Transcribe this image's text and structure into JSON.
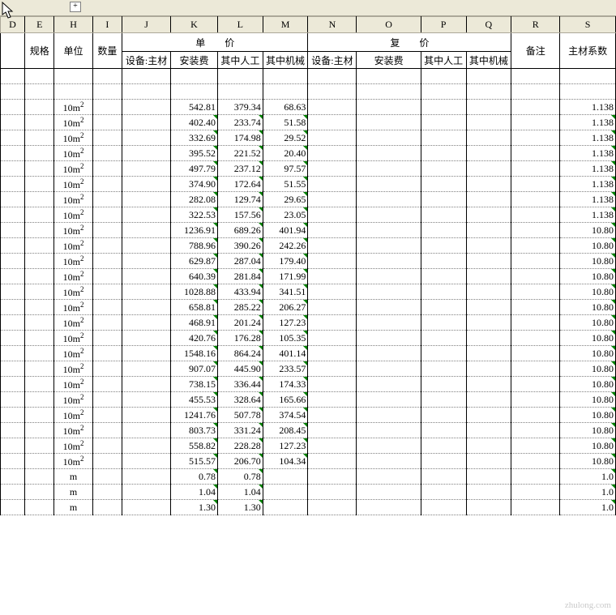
{
  "expand": "+",
  "columns": [
    "D",
    "E",
    "H",
    "I",
    "J",
    "K",
    "L",
    "M",
    "N",
    "O",
    "P",
    "Q",
    "R",
    "S"
  ],
  "header1": {
    "gg": "规格",
    "dw": "单位",
    "sl": "数量",
    "dj": "单　　价",
    "fj": "复　　价",
    "bz": "备注",
    "zcxs": "主材系数"
  },
  "header2": {
    "sbzc": "设备:主材",
    "azf": "安装费",
    "qzrg": "其中人工",
    "qzjx": "其中机械",
    "sbzc2": "设备:主材",
    "azf2": "安装费",
    "qzrg2": "其中人工",
    "qzjx2": "其中机械"
  },
  "unit10m2": "10m²",
  "unitM": "m",
  "rows": [
    {
      "type": "blank"
    },
    {
      "type": "blank"
    },
    {
      "u": "10m2",
      "k": "542.81",
      "l": "379.34",
      "m": "68.63",
      "s": "1.138",
      "ktri": 0,
      "ltri": 0,
      "mtri": 0,
      "stri": 0
    },
    {
      "u": "10m2",
      "k": "402.40",
      "l": "233.74",
      "m": "51.58",
      "s": "1.138",
      "ktri": 1,
      "ltri": 1,
      "mtri": 1,
      "stri": 1
    },
    {
      "u": "10m2",
      "k": "332.69",
      "l": "174.98",
      "m": "29.52",
      "s": "1.138",
      "ktri": 1,
      "ltri": 1,
      "mtri": 1,
      "stri": 1
    },
    {
      "u": "10m2",
      "k": "395.52",
      "l": "221.52",
      "m": "20.40",
      "s": "1.138",
      "ktri": 1,
      "ltri": 1,
      "mtri": 1,
      "stri": 1
    },
    {
      "u": "10m2",
      "k": "497.79",
      "l": "237.12",
      "m": "97.57",
      "s": "1.138",
      "ktri": 1,
      "ltri": 1,
      "mtri": 1,
      "stri": 1
    },
    {
      "u": "10m2",
      "k": "374.90",
      "l": "172.64",
      "m": "51.55",
      "s": "1.138",
      "ktri": 1,
      "ltri": 1,
      "mtri": 1,
      "stri": 1
    },
    {
      "u": "10m2",
      "k": "282.08",
      "l": "129.74",
      "m": "29.65",
      "s": "1.138",
      "ktri": 1,
      "ltri": 1,
      "mtri": 1,
      "stri": 1
    },
    {
      "u": "10m2",
      "k": "322.53",
      "l": "157.56",
      "m": "23.05",
      "s": "1.138",
      "ktri": 1,
      "ltri": 1,
      "mtri": 1,
      "stri": 1
    },
    {
      "u": "10m2",
      "k": "1236.91",
      "l": "689.26",
      "m": "401.94",
      "s": "10.80",
      "ktri": 1,
      "ltri": 1,
      "mtri": 1,
      "stri": 1
    },
    {
      "u": "10m2",
      "k": "788.96",
      "l": "390.26",
      "m": "242.26",
      "s": "10.80",
      "ktri": 1,
      "ltri": 1,
      "mtri": 1,
      "stri": 1
    },
    {
      "u": "10m2",
      "k": "629.87",
      "l": "287.04",
      "m": "179.40",
      "s": "10.80",
      "ktri": 1,
      "ltri": 1,
      "mtri": 1,
      "stri": 1
    },
    {
      "u": "10m2",
      "k": "640.39",
      "l": "281.84",
      "m": "171.99",
      "s": "10.80",
      "ktri": 1,
      "ltri": 1,
      "mtri": 1,
      "stri": 1
    },
    {
      "u": "10m2",
      "k": "1028.88",
      "l": "433.94",
      "m": "341.51",
      "s": "10.80",
      "ktri": 1,
      "ltri": 1,
      "mtri": 1,
      "stri": 1
    },
    {
      "u": "10m2",
      "k": "658.81",
      "l": "285.22",
      "m": "206.27",
      "s": "10.80",
      "ktri": 1,
      "ltri": 1,
      "mtri": 1,
      "stri": 1
    },
    {
      "u": "10m2",
      "k": "468.91",
      "l": "201.24",
      "m": "127.23",
      "s": "10.80",
      "ktri": 1,
      "ltri": 1,
      "mtri": 1,
      "stri": 1
    },
    {
      "u": "10m2",
      "k": "420.76",
      "l": "176.28",
      "m": "105.35",
      "s": "10.80",
      "ktri": 1,
      "ltri": 1,
      "mtri": 1,
      "stri": 1
    },
    {
      "u": "10m2",
      "k": "1548.16",
      "l": "864.24",
      "m": "401.14",
      "s": "10.80",
      "ktri": 1,
      "ltri": 1,
      "mtri": 1,
      "stri": 1
    },
    {
      "u": "10m2",
      "k": "907.07",
      "l": "445.90",
      "m": "233.57",
      "s": "10.80",
      "ktri": 1,
      "ltri": 1,
      "mtri": 1,
      "stri": 1
    },
    {
      "u": "10m2",
      "k": "738.15",
      "l": "336.44",
      "m": "174.33",
      "s": "10.80",
      "ktri": 1,
      "ltri": 1,
      "mtri": 1,
      "stri": 1
    },
    {
      "u": "10m2",
      "k": "455.53",
      "l": "328.64",
      "m": "165.66",
      "s": "10.80",
      "ktri": 1,
      "ltri": 1,
      "mtri": 1,
      "stri": 1
    },
    {
      "u": "10m2",
      "k": "1241.76",
      "l": "507.78",
      "m": "374.54",
      "s": "10.80",
      "ktri": 1,
      "ltri": 1,
      "mtri": 1,
      "stri": 1
    },
    {
      "u": "10m2",
      "k": "803.73",
      "l": "331.24",
      "m": "208.45",
      "s": "10.80",
      "ktri": 1,
      "ltri": 1,
      "mtri": 1,
      "stri": 1
    },
    {
      "u": "10m2",
      "k": "558.82",
      "l": "228.28",
      "m": "127.23",
      "s": "10.80",
      "ktri": 1,
      "ltri": 1,
      "mtri": 1,
      "stri": 1
    },
    {
      "u": "10m2",
      "k": "515.57",
      "l": "206.70",
      "m": "104.34",
      "s": "10.80",
      "ktri": 1,
      "ltri": 1,
      "mtri": 1,
      "stri": 1
    },
    {
      "u": "m",
      "k": "0.78",
      "l": "0.78",
      "m": "",
      "s": "1.0",
      "ktri": 1,
      "ltri": 1,
      "mtri": 0,
      "stri": 1
    },
    {
      "u": "m",
      "k": "1.04",
      "l": "1.04",
      "m": "",
      "s": "1.0",
      "ktri": 1,
      "ltri": 1,
      "mtri": 0,
      "stri": 1
    },
    {
      "u": "m",
      "k": "1.30",
      "l": "1.30",
      "m": "",
      "s": "1.0",
      "ktri": 1,
      "ltri": 1,
      "mtri": 0,
      "stri": 1
    }
  ],
  "watermark": "zhulong.com"
}
